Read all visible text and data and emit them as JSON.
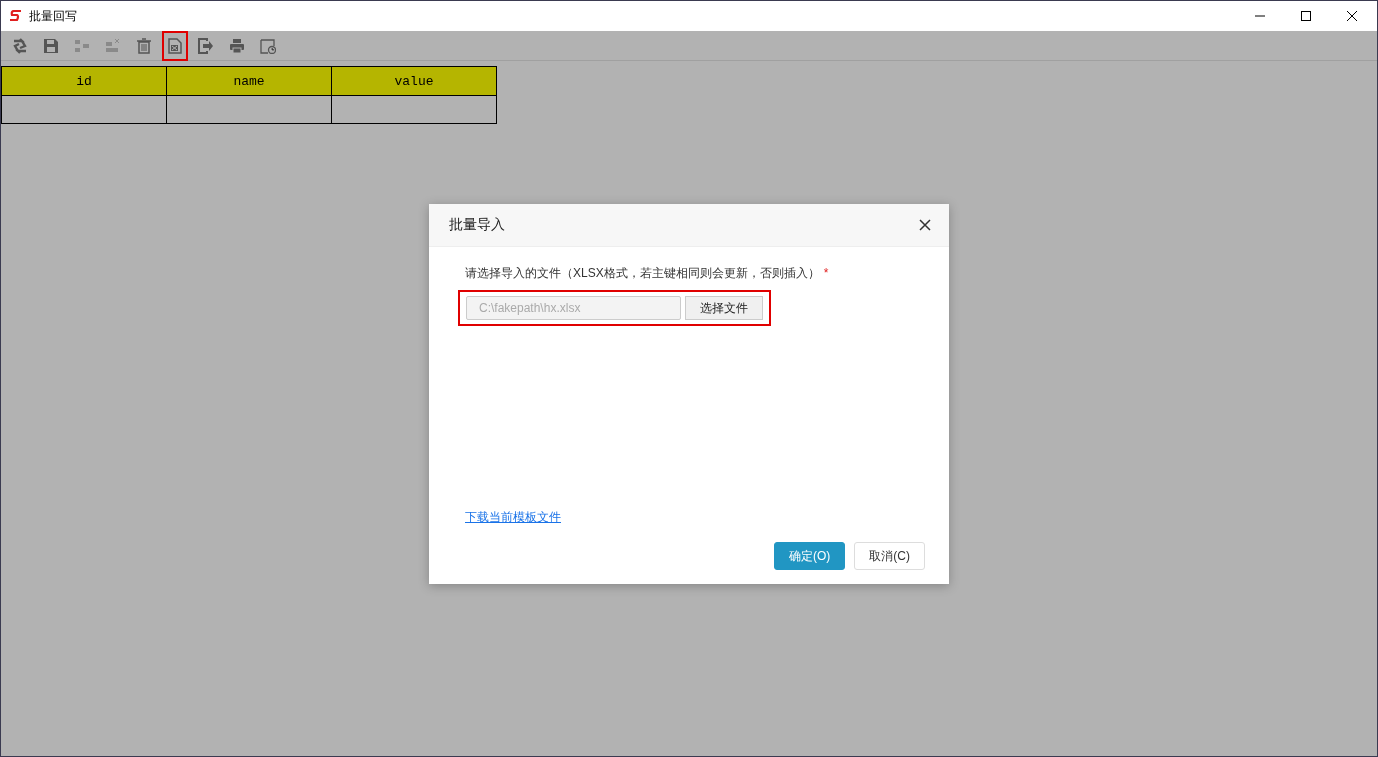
{
  "window": {
    "title": "批量回写"
  },
  "toolbar": [
    {
      "kind": "refresh",
      "disabled": false,
      "highlighted": false
    },
    {
      "kind": "save",
      "disabled": false,
      "highlighted": false
    },
    {
      "kind": "insert",
      "disabled": true,
      "highlighted": false
    },
    {
      "kind": "remove",
      "disabled": true,
      "highlighted": false
    },
    {
      "kind": "trash",
      "disabled": false,
      "highlighted": false
    },
    {
      "kind": "import",
      "disabled": false,
      "highlighted": true
    },
    {
      "kind": "export",
      "disabled": false,
      "highlighted": false
    },
    {
      "kind": "print",
      "disabled": false,
      "highlighted": false
    },
    {
      "kind": "schedule",
      "disabled": false,
      "highlighted": false
    }
  ],
  "table": {
    "columns": [
      "id",
      "name",
      "value"
    ]
  },
  "dialog": {
    "title": "批量导入",
    "label": "请选择导入的文件（XLSX格式，若主键相同则会更新，否则插入）",
    "required_mark": "*",
    "file_picker": {
      "value": "C:\\fakepath\\hx.xlsx",
      "button": "选择文件",
      "highlighted": true
    },
    "link": "下载当前模板文件",
    "buttons": [
      {
        "label": "确定(O)",
        "kind": "primary"
      },
      {
        "label": "取消(C)",
        "kind": "default"
      }
    ]
  }
}
